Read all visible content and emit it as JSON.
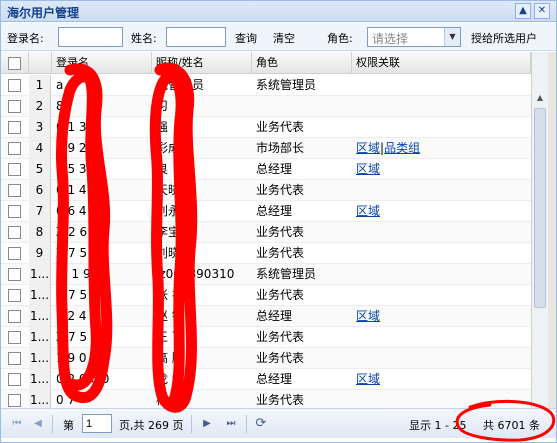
{
  "window": {
    "title": "海尔用户管理",
    "collapse_icon": "chevron-up-icon",
    "close_icon": "close-icon"
  },
  "search": {
    "login_label": "登录名:",
    "login_value": "",
    "name_label": "姓名:",
    "name_value": "",
    "query_label": "查询",
    "clear_label": "清空",
    "role_label": "角色:",
    "role_placeholder": "请选择",
    "grant_label": "授给所选用户"
  },
  "grid": {
    "columns": [
      "登录名",
      "昵称/姓名",
      "角色",
      "权限关联"
    ],
    "rows": [
      {
        "num": "1",
        "login": "a  n",
        "nick": "统管理员",
        "role": "系统管理员",
        "perm": []
      },
      {
        "num": "2",
        "login": "  8",
        "nick": "习",
        "role": "",
        "perm": []
      },
      {
        "num": "3",
        "login": "0 1  3 7",
        "nick": "强",
        "role": "业务代表",
        "perm": []
      },
      {
        "num": "4",
        "login": "0 9  2 9",
        "nick": "彩成",
        "role": "市场部长",
        "perm": [
          "区域",
          "品类组"
        ]
      },
      {
        "num": "5",
        "login": "0 5  3",
        "nick": "良",
        "role": "总经理",
        "perm": [
          "区域"
        ]
      },
      {
        "num": "6",
        "login": "0 1  4 7",
        "nick": "天晓明",
        "role": "业务代表",
        "perm": []
      },
      {
        "num": "7",
        "login": "0 6  4 8",
        "nick": "刘永彬",
        "role": "总经理",
        "perm": [
          "区域"
        ]
      },
      {
        "num": "8",
        "login": "Z 2 6  4",
        "nick": "李宝民",
        "role": "业务代表",
        "perm": []
      },
      {
        "num": "9",
        "login": "Z 7 5  7",
        "nick": "刘晓明",
        "role": "业务代表",
        "perm": []
      },
      {
        "num": "1...",
        "login": "m  1 9 9",
        "nick": "lz008890310",
        "role": "系统管理员",
        "perm": []
      },
      {
        "num": "1...",
        "login": "Z 7 5  7 4",
        "nick": "张 礼",
        "role": "业务代表",
        "perm": []
      },
      {
        "num": "1...",
        "login": "1 2  4",
        "nick": "赵 锋",
        "role": "总经理",
        "perm": [
          "区域"
        ]
      },
      {
        "num": "1...",
        "login": "Z 7 5  7",
        "nick": "王 飞",
        "role": "业务代表",
        "perm": []
      },
      {
        "num": "1...",
        "login": "1 9  0 1",
        "nick": "高 鹏",
        "role": "业务代表",
        "perm": []
      },
      {
        "num": "1...",
        "login": "0 2 0  6 0",
        "nick": "龙 林",
        "role": "总经理",
        "perm": [
          "区域"
        ]
      },
      {
        "num": "1...",
        "login": "0    7",
        "nick": "杨 ",
        "role": "业务代表",
        "perm": []
      }
    ]
  },
  "pager": {
    "page_prefix": "第",
    "page_value": "1",
    "page_suffix": "页,共 269 页",
    "display": "显示 1 - 25 ",
    "total": "共 6701 条",
    "icons": [
      "first-page-icon",
      "prev-page-icon",
      "next-page-icon",
      "last-page-icon",
      "refresh-icon"
    ]
  },
  "colors": {
    "accent": "#15428b",
    "border": "#99bbe8",
    "link": "#0645ad",
    "scribble": "#ff0000"
  }
}
